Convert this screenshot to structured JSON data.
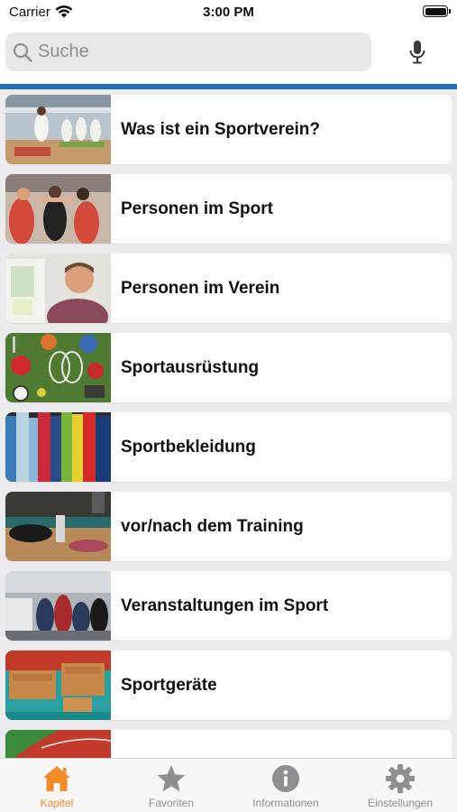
{
  "status_bar": {
    "carrier": "Carrier",
    "time": "3:00 PM"
  },
  "search": {
    "placeholder": "Suche"
  },
  "colors": {
    "accent_line": "#1e6fb8",
    "active_tab": "#f28c28",
    "inactive_tab": "#8e8e93"
  },
  "chapters": [
    {
      "label": "Was ist ein Sportverein?",
      "image": "karate-class-photo"
    },
    {
      "label": "Personen im Sport",
      "image": "team-high-five-photo"
    },
    {
      "label": "Personen im Verein",
      "image": "smiling-man-photo"
    },
    {
      "label": "Sportausrüstung",
      "image": "sports-equipment-photo"
    },
    {
      "label": "Sportbekleidung",
      "image": "jerseys-on-rack-photo"
    },
    {
      "label": "vor/nach dem Training",
      "image": "gym-floor-stretching-photo"
    },
    {
      "label": "Veranstaltungen im Sport",
      "image": "team-on-bench-photo"
    },
    {
      "label": "Sportgeräte",
      "image": "vaulting-boxes-photo"
    },
    {
      "label": "",
      "image": "running-track-photo"
    }
  ],
  "tabs": [
    {
      "label": "Kapitel",
      "icon": "house-icon",
      "active": true
    },
    {
      "label": "Favoriten",
      "icon": "star-icon",
      "active": false
    },
    {
      "label": "Informationen",
      "icon": "info-icon",
      "active": false
    },
    {
      "label": "Einstellungen",
      "icon": "gear-icon",
      "active": false
    }
  ]
}
